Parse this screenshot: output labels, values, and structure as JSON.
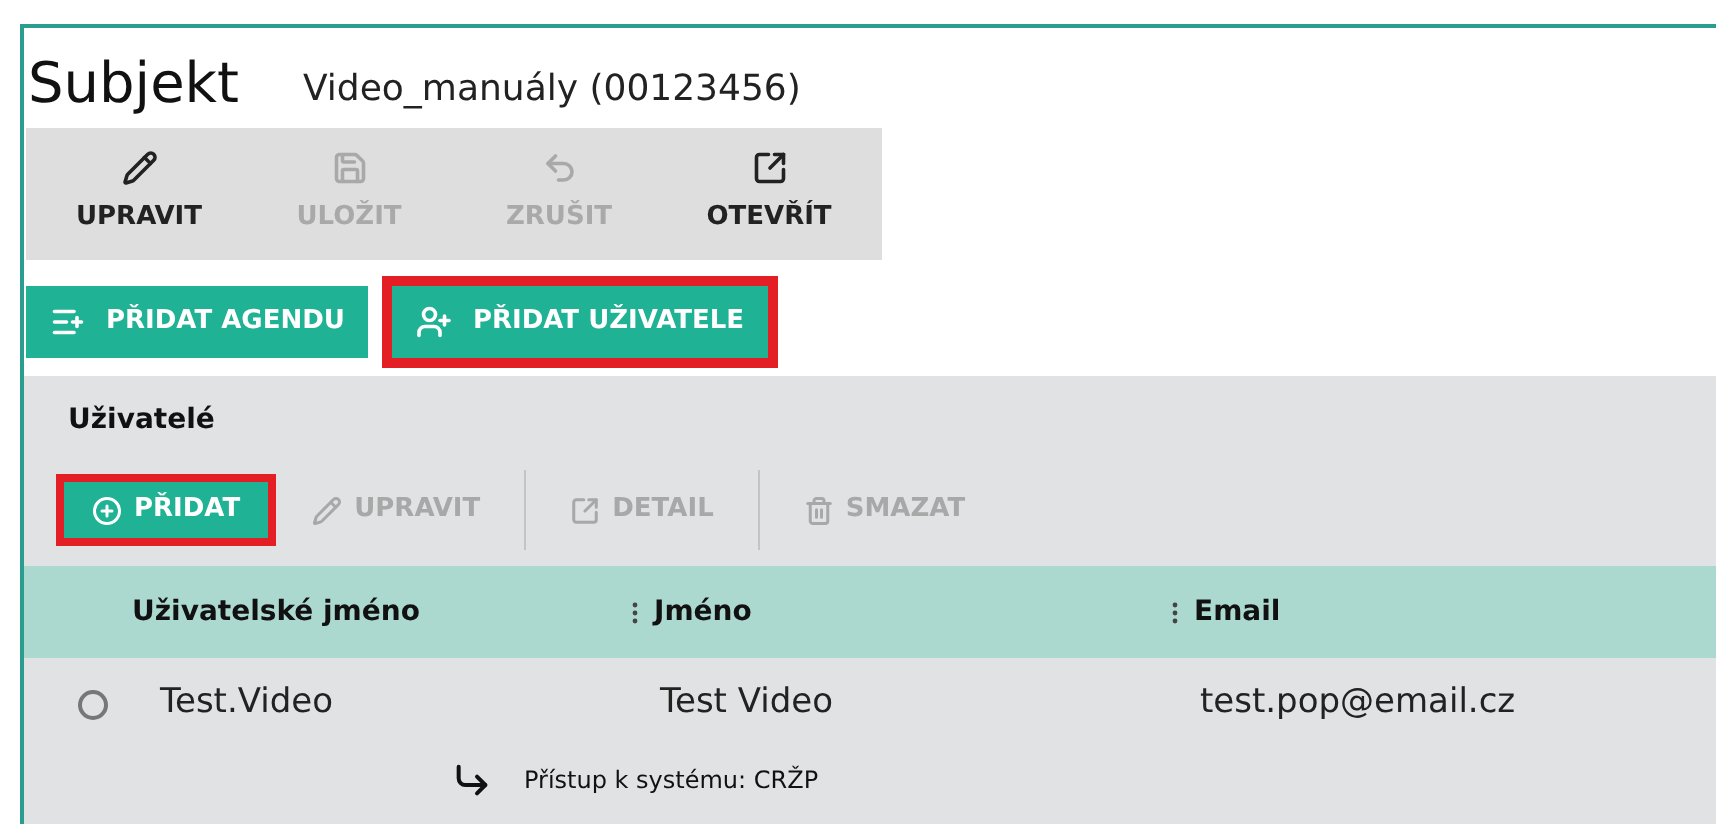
{
  "header": {
    "title": "Subjekt",
    "subtitle": "Video_manuály (00123456)"
  },
  "toolbar": [
    {
      "label": "UPRAVIT",
      "disabled": false
    },
    {
      "label": "ULOŽIT",
      "disabled": true
    },
    {
      "label": "ZRUŠIT",
      "disabled": true
    },
    {
      "label": "OTEVŘÍT",
      "disabled": false
    }
  ],
  "actions": [
    {
      "label": "PŘIDAT AGENDU",
      "highlighted": false
    },
    {
      "label": "PŘIDAT UŽIVATELE",
      "highlighted": true
    }
  ],
  "users": {
    "title": "Uživatelé",
    "toolbar": [
      {
        "label": "PŘIDAT",
        "disabled": false,
        "highlighted": true
      },
      {
        "label": "UPRAVIT",
        "disabled": true,
        "highlighted": false
      },
      {
        "label": "DETAIL",
        "disabled": true,
        "highlighted": false
      },
      {
        "label": "SMAZAT",
        "disabled": true,
        "highlighted": false
      }
    ],
    "columns": [
      "Uživatelské jméno",
      "Jméno",
      "Email"
    ],
    "rows": [
      {
        "selected": false,
        "cells": [
          "Test.Video",
          "Test Video",
          "test.pop@email.cz"
        ],
        "detail": "Přístup k systému: CRŽP"
      }
    ]
  }
}
